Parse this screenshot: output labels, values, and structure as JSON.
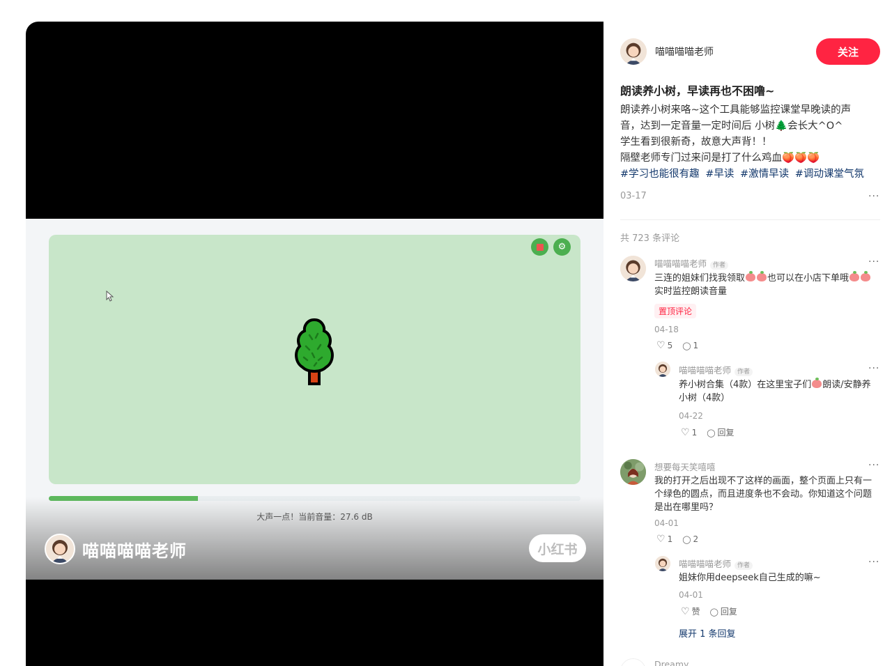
{
  "video": {
    "volume_text": "大声一点！当前音量：27.6 dB",
    "progress_fraction": 0.28,
    "overlay_author": "喵喵喵喵老师",
    "watermark": "小红书"
  },
  "post": {
    "author": "喵喵喵喵老师",
    "follow_label": "关注",
    "title": "朗读养小树，早读再也不困噜~",
    "body_lines": [
      "朗读养小树来咯~这个工具能够监控课堂早晚读的声",
      "音，达到一定音量一定时间后 小树🌲会长大^O^",
      "学生看到很新奇，故意大声背！！",
      "隔壁老师专门过来问是打了什么鸡血🍑🍑🍑"
    ],
    "tags": [
      "#学习也能很有趣",
      "#早读",
      "#激情早读",
      "#调动课堂气氛"
    ],
    "date": "03-17",
    "more": "···"
  },
  "comments_header": {
    "count_text": "共 723 条评论"
  },
  "comments": [
    {
      "name": "喵喵喵喵老师",
      "author_tag": "作者",
      "text_lines": [
        "三连的姐妹们找我领取🍑🍑也可以在小店下单哦🍑🍑",
        "实时监控朗读音量"
      ],
      "pin": "置顶评论",
      "date": "04-18",
      "likes": "5",
      "replies": "1"
    },
    {
      "name": "喵喵喵喵老师",
      "author_tag": "作者",
      "text_lines": [
        "养小树合集（4款）在这里宝子们🍑朗读/安静养",
        "小树（4款）"
      ],
      "date": "04-22",
      "likes": "1",
      "reply_label": "回复"
    },
    {
      "name": "想要每天笑嘻嘻",
      "text_lines": [
        "我的打开之后出现不了这样的画面，整个页面上只有一",
        "个绿色的圆点，而且进度条也不会动。你知道这个问题",
        "是出在哪里吗？"
      ],
      "date": "04-01",
      "likes": "1",
      "replies": "2"
    },
    {
      "name": "喵喵喵喵老师",
      "author_tag": "作者",
      "text_lines": [
        "姐妹你用deepseek自己生成的嘛~"
      ],
      "date": "04-01",
      "likes": "赞",
      "reply_label": "回复",
      "expand": "展开 1 条回复"
    },
    {
      "name": "Dreamy"
    }
  ]
}
